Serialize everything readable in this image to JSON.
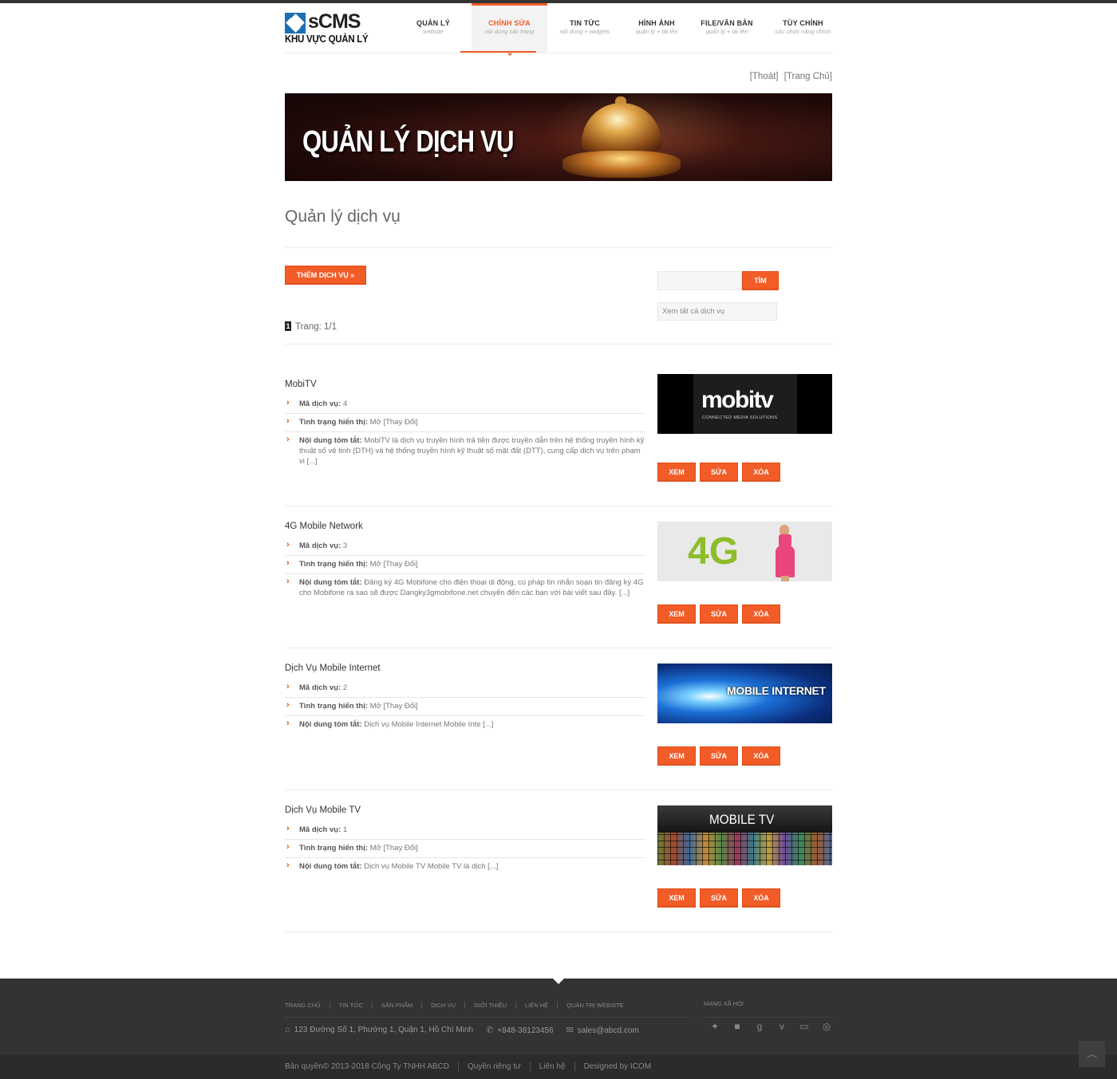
{
  "header": {
    "logo_brand": "sCMS",
    "logo_sub": "KHU VỰC QUẢN LÝ",
    "nav": [
      {
        "title": "QUẢN LÝ",
        "sub": "website"
      },
      {
        "title": "CHỈNH SỬA",
        "sub": "nội dung các trang"
      },
      {
        "title": "TIN TỨC",
        "sub": "nội dung + widgets"
      },
      {
        "title": "HÌNH ẢNH",
        "sub": "quản lý + tải lên"
      },
      {
        "title": "FILE/VĂN BẢN",
        "sub": "quản lý + tải lên"
      },
      {
        "title": "TÙY CHỈNH",
        "sub": "các chức năng chính"
      }
    ],
    "logout": "[Thoát]",
    "home": "[Trang Chủ]"
  },
  "banner": {
    "title": "QUẢN LÝ DỊCH VỤ"
  },
  "page": {
    "title": "Quản lý dịch vụ",
    "add_button": "THÊM DỊCH VỤ »",
    "search_button": "TÌM",
    "search_value": "",
    "view_all": "Xem tất cả dịch vụ",
    "page_number": "1",
    "page_info": "Trang: 1/1"
  },
  "labels": {
    "code": "Mã dịch vụ:",
    "status": "Tình trạng hiển thị:",
    "summary": "Nội dung tóm tắt:",
    "change": "[Thay Đổi]",
    "view": "XEM",
    "edit": "SỬA",
    "delete": "XÓA"
  },
  "services": [
    {
      "name": "MobiTV",
      "code": "4",
      "status": "Mở",
      "summary": "MobiTV là dịch vụ truyền hình trả tiền được truyền dẫn trên hệ thống truyền hình kỹ thuật số vệ tinh (DTH) và hệ thống truyền hình kỹ thuật số mặt đất (DTT), cung cấp dịch vụ trên phạm vi [...]",
      "thumb_word": "mobitv",
      "thumb_caption": "CONNECTED MEDIA SOLUTIONS"
    },
    {
      "name": "4G Mobile Network",
      "code": "3",
      "status": "Mở",
      "summary": "Đăng ký 4G Mobifone cho điện thoại di động, cú pháp tin nhắn soạn tin đăng ký 4G cho Mobifone ra sao sẽ được Dangky3gmobifone.net chuyển đến các bạn với bài viết sau đây. [...]",
      "thumb_word": "4G"
    },
    {
      "name": "Dịch Vụ Mobile Internet",
      "code": "2",
      "status": "Mở",
      "summary": "Dịch vụ Mobile Internet Mobile Inte [...]",
      "thumb_word": "MOBILE INTERNET"
    },
    {
      "name": "Dịch Vụ Mobile TV",
      "code": "1",
      "status": "Mở",
      "summary": "Dịch vụ Mobile TV Mobile TV là dịch [...]",
      "thumb_word": "MOBILE TV"
    }
  ],
  "footer": {
    "nav": [
      "TRANG CHỦ",
      "TIN TỨC",
      "SẢN PHẨM",
      "DỊCH VỤ",
      "GIỚI THIỆU",
      "LIÊN HỆ",
      "QUẢN TRỊ WEBSITE"
    ],
    "address": "123 Đường Số 1, Phường 1, Quận 1, Hồ Chí Minh",
    "phone": "+848-38123456",
    "email": "sales@abcd.com",
    "social_title": "MẠNG XÃ HỘI",
    "copyright": "Bản quyền© 2013-2018 Công Ty TNHH ABCD",
    "privacy": "Quyền riêng tư",
    "contact": "Liên hệ",
    "designed": "Designed by ICOM"
  },
  "colors": {
    "accent": "#f25c27",
    "footer_bg": "#333333"
  }
}
